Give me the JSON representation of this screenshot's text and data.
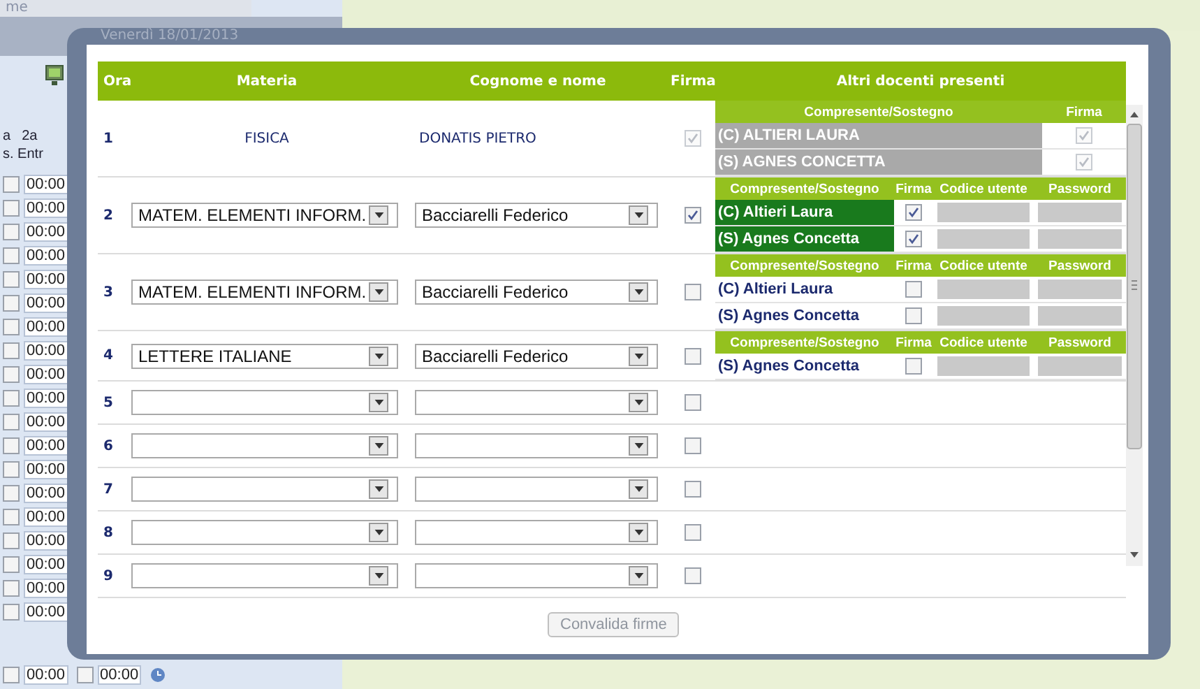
{
  "page_header": {
    "tab_label": "me"
  },
  "background": {
    "column_labels": [
      "a",
      "2a",
      "s. Entr"
    ],
    "time_rows": [
      {
        "time": "00:00",
        "checked": false
      },
      {
        "time": "00:00",
        "checked": false
      },
      {
        "time": "00:00",
        "checked": false
      },
      {
        "time": "00:00",
        "checked": false
      },
      {
        "time": "00:00",
        "checked": false
      },
      {
        "time": "00:00",
        "checked": false
      },
      {
        "time": "00:00",
        "checked": false
      },
      {
        "time": "00:00",
        "checked": false
      },
      {
        "time": "00:00",
        "checked": false
      },
      {
        "time": "00:00",
        "checked": false
      },
      {
        "time": "00:00",
        "checked": false
      },
      {
        "time": "00:00",
        "checked": false
      },
      {
        "time": "00:00",
        "checked": false
      },
      {
        "time": "00:00",
        "checked": false
      },
      {
        "time": "00:00",
        "checked": false
      },
      {
        "time": "00:00",
        "checked": false
      },
      {
        "time": "00:00",
        "checked": false
      },
      {
        "time": "00:00",
        "checked": false
      },
      {
        "time": "00:00",
        "checked": false
      }
    ],
    "bottom_row": [
      {
        "time": "00:00",
        "checked": false
      },
      {
        "time": "00:00",
        "checked": false
      }
    ]
  },
  "dialog": {
    "date": "Venerdì 18/01/2013",
    "columns": [
      "Ora",
      "Materia",
      "Cognome e nome",
      "Firma",
      "Altri docenti presenti"
    ],
    "lessons": [
      {
        "ora": "1",
        "subject": {
          "kind": "text",
          "value": "FISICA"
        },
        "teacher": {
          "kind": "text",
          "value": "DONATIS PIETRO"
        },
        "signed": true,
        "signature_disabled": true,
        "others": {
          "kind": "simple",
          "columns": [
            "Compresente/Sostegno",
            "Firma"
          ],
          "teachers": [
            {
              "name": "(C) ALTIERI LAURA",
              "signed": true,
              "disabled": true,
              "selected": false
            },
            {
              "name": "(S) AGNES CONCETTA",
              "signed": true,
              "disabled": true,
              "selected": false
            }
          ]
        }
      },
      {
        "ora": "2",
        "subject": {
          "kind": "select",
          "value": "MATEM. ELEMENTI INFORM."
        },
        "teacher": {
          "kind": "select",
          "value": "Bacciarelli Federico"
        },
        "signed": true,
        "signature_disabled": false,
        "others": {
          "kind": "credentials",
          "columns": [
            "Compresente/Sostegno",
            "Firma",
            "Codice utente",
            "Password"
          ],
          "teachers": [
            {
              "name": "(C) Altieri Laura",
              "signed": true,
              "disabled": false,
              "selected": true
            },
            {
              "name": "(S) Agnes Concetta",
              "signed": true,
              "disabled": false,
              "selected": true
            }
          ]
        }
      },
      {
        "ora": "3",
        "subject": {
          "kind": "select",
          "value": "MATEM. ELEMENTI INFORM."
        },
        "teacher": {
          "kind": "select",
          "value": "Bacciarelli Federico"
        },
        "signed": false,
        "signature_disabled": false,
        "others": {
          "kind": "credentials",
          "columns": [
            "Compresente/Sostegno",
            "Firma",
            "Codice utente",
            "Password"
          ],
          "teachers": [
            {
              "name": "(C) Altieri Laura",
              "signed": false,
              "disabled": false,
              "selected": false
            },
            {
              "name": "(S) Agnes Concetta",
              "signed": false,
              "disabled": false,
              "selected": false
            }
          ]
        }
      },
      {
        "ora": "4",
        "subject": {
          "kind": "select",
          "value": "LETTERE ITALIANE"
        },
        "teacher": {
          "kind": "select",
          "value": "Bacciarelli Federico"
        },
        "signed": false,
        "signature_disabled": false,
        "others": {
          "kind": "credentials",
          "columns": [
            "Compresente/Sostegno",
            "Firma",
            "Codice utente",
            "Password"
          ],
          "teachers": [
            {
              "name": "(S) Agnes Concetta",
              "signed": false,
              "disabled": false,
              "selected": false
            }
          ]
        }
      },
      {
        "ora": "5",
        "subject": {
          "kind": "select"
        },
        "teacher": {
          "kind": "select"
        },
        "signed": false,
        "signature_disabled": false
      },
      {
        "ora": "6",
        "subject": {
          "kind": "select"
        },
        "teacher": {
          "kind": "select"
        },
        "signed": false,
        "signature_disabled": false
      },
      {
        "ora": "7",
        "subject": {
          "kind": "select"
        },
        "teacher": {
          "kind": "select"
        },
        "signed": false,
        "signature_disabled": false
      },
      {
        "ora": "8",
        "subject": {
          "kind": "select"
        },
        "teacher": {
          "kind": "select"
        },
        "signed": false,
        "signature_disabled": false
      },
      {
        "ora": "9",
        "subject": {
          "kind": "select"
        },
        "teacher": {
          "kind": "select"
        },
        "signed": false,
        "signature_disabled": false
      }
    ],
    "confirm_button": {
      "label": "Convalida firme",
      "disabled": true
    }
  }
}
